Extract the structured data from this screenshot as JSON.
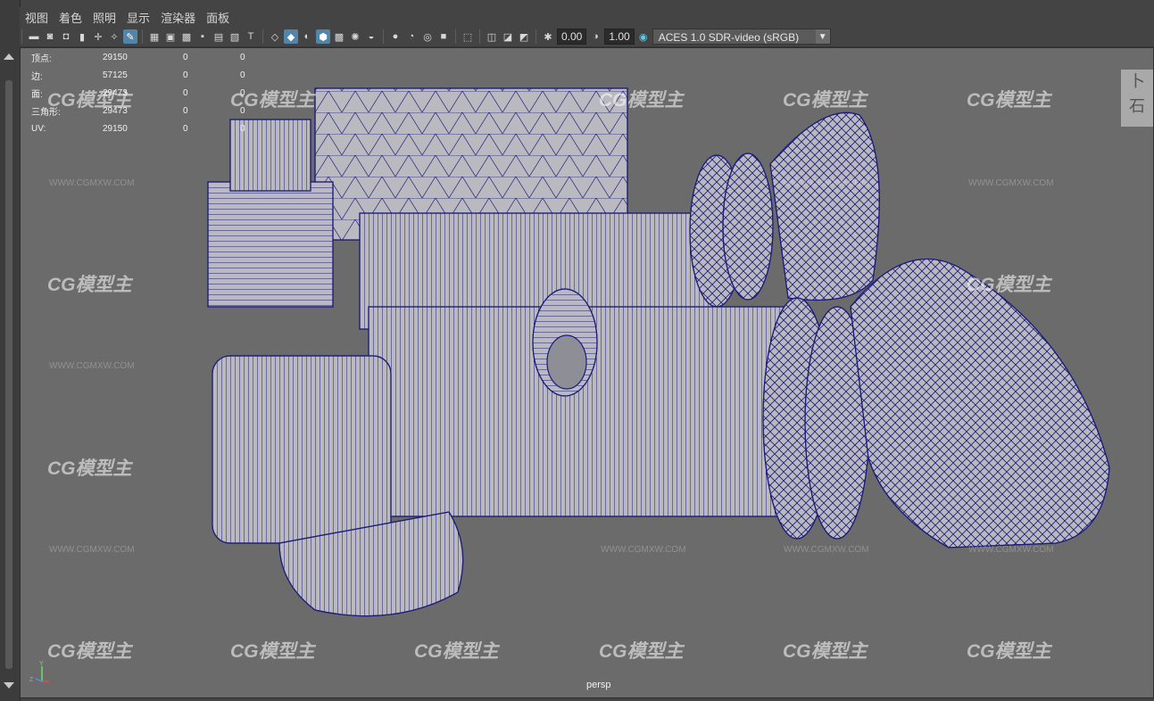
{
  "menu": [
    "视图",
    "着色",
    "照明",
    "显示",
    "渲染器",
    "面板"
  ],
  "toolbar": {
    "exposure": "0.00",
    "gamma": "1.00",
    "color_space": "ACES 1.0 SDR-video (sRGB)"
  },
  "hud": {
    "rows": [
      {
        "label": "顶点:",
        "v1": "29150",
        "v2": "0",
        "v3": "0"
      },
      {
        "label": "边:",
        "v1": "57125",
        "v2": "0",
        "v3": "0"
      },
      {
        "label": "面:",
        "v1": "29473",
        "v2": "0",
        "v3": "0"
      },
      {
        "label": "三角形:",
        "v1": "29473",
        "v2": "0",
        "v3": "0"
      },
      {
        "label": "UV:",
        "v1": "29150",
        "v2": "0",
        "v3": "0"
      }
    ]
  },
  "camera_label": "persp",
  "watermark": {
    "brand": "CG模型主",
    "url": "WWW.CGMXW.COM"
  },
  "corner_image_text": [
    "卜",
    "石"
  ],
  "colors": {
    "wire": "#1c1c7a",
    "surface": "#b9b9bf",
    "viewport_bg": "#6b6b6b",
    "active_icon": "#5285a6"
  },
  "axis": {
    "y": "Y",
    "z": "Z"
  }
}
